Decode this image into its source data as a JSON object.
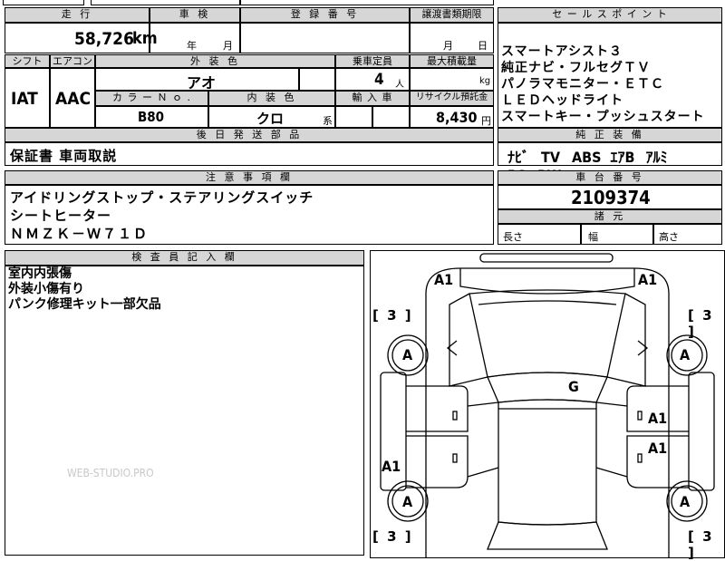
{
  "headers": {
    "mileage": "走 行",
    "inspection": "車 検",
    "registration": "登 録 番 号",
    "transfer_deadline": "譲渡書類期限",
    "selling_points": "セ ー ル ス ポ イ ン ト",
    "shift": "シフト",
    "aircon": "エアコン",
    "ext_color": "外 装 色",
    "capacity": "乗車定員",
    "max_load": "最大積載量",
    "color_no": "カ ラ ー Ｎ ｏ .",
    "int_color": "内 装 色",
    "import": "輸 入 車",
    "recycle": "リサイクル預託金",
    "equipment": "純 正 装 備",
    "later_parts": "後 日 発 送 部 品",
    "notes": "注 意 事 項 欄",
    "chassis_no": "車 台 番 号",
    "dimensions": "諸 元",
    "inspector": "検 査 員 記 入 欄"
  },
  "values": {
    "mileage": "58,726",
    "mileage_unit": "km",
    "year_unit": "年",
    "month_unit": "月",
    "transfer_month_unit": "月",
    "transfer_day_unit": "日",
    "shift": "IAT",
    "aircon": "AAC",
    "ext_color": "アオ",
    "capacity": "4",
    "capacity_unit": "人",
    "max_load_unit": "kg",
    "color_no": "B80",
    "int_color": "クロ",
    "int_color_suffix": "系",
    "recycle": "8,430",
    "recycle_unit": "円",
    "later_parts": "保証書 車両取説",
    "chassis_no": "2109374",
    "length_label": "長さ",
    "width_label": "幅",
    "height_label": "高さ"
  },
  "selling_points": [
    "スマートアシスト３",
    "純正ナビ・フルセグＴＶ",
    "パノラマモニター・ＥＴＣ",
    "ＬＥＤヘッドライト",
    "スマートキー・プッシュスタート"
  ],
  "equipment": [
    "ﾅﾋﾞ",
    "TV",
    "ABS",
    "ｴｱB",
    "ｱﾙﾐ",
    "PS",
    "PW"
  ],
  "notes": [
    "アイドリングストップ・ステアリングスイッチ",
    "シートヒーター",
    "ＮＭＺＫ－Ｗ７１Ｄ"
  ],
  "inspector_notes": [
    "室内内張傷",
    "外装小傷有り",
    "パンク修理キット一部欠品"
  ],
  "diagram": {
    "tire_label": "[ 3 ]",
    "wheel_label": "A",
    "damage_front_left": "A1",
    "damage_front_right": "A1",
    "damage_roof": "G",
    "damage_right_front_door": "A1",
    "damage_right_rear_door": "A1",
    "damage_left_rear": "A1"
  },
  "watermark": "WEB-STUDIO.PRO"
}
